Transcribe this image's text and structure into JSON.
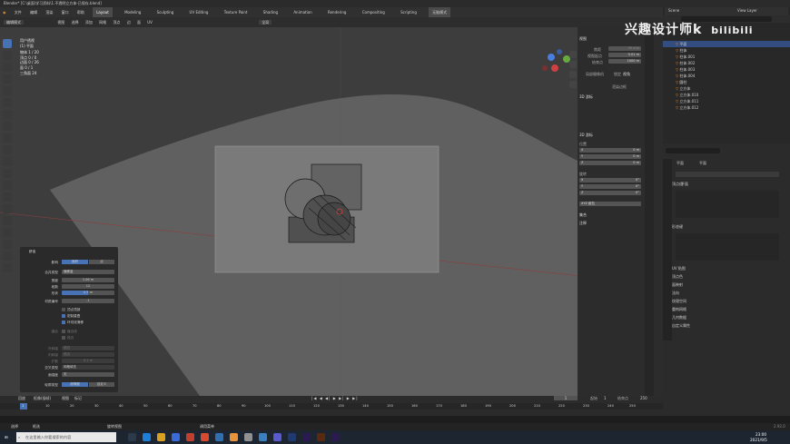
{
  "titlebar": {
    "title": "Blender* [C:\\桌面\\学习资料\\1.不透明立方体-已保存.blend]"
  },
  "menus": [
    "文件",
    "编辑",
    "渲染",
    "窗口",
    "帮助"
  ],
  "workspaces": [
    {
      "label": "Layout",
      "active": true
    },
    {
      "label": "Modeling",
      "active": false
    },
    {
      "label": "Sculpting",
      "active": false
    },
    {
      "label": "UV Editing",
      "active": false
    },
    {
      "label": "Texture Paint",
      "active": false
    },
    {
      "label": "Shading",
      "active": false
    },
    {
      "label": "Animation",
      "active": false
    },
    {
      "label": "Rendering",
      "active": false
    },
    {
      "label": "Compositing",
      "active": false
    },
    {
      "label": "Scripting",
      "active": false
    }
  ],
  "topright": {
    "scene": "Scene",
    "view_layer": "View Layer",
    "mode_badge": "无脑模式"
  },
  "viewport_header": {
    "mode": "编辑模式",
    "items": [
      "视图",
      "选择",
      "添加",
      "网格",
      "顶点",
      "边",
      "面",
      "UV"
    ],
    "orientation": "全局"
  },
  "viewport_info": {
    "line1": "用户透视",
    "line2": "(1) 平面",
    "stats": [
      "物体  1 / 20",
      "顶点  0 / 0",
      "边面  0 / 26",
      "面  0 / 1",
      "三角面  24"
    ]
  },
  "npanel": {
    "view_title": "视图",
    "focal_label": "焦距",
    "focal_value": "50 mm",
    "clip_start_label": "视图起点",
    "clip_start_value": "0.01 m",
    "clip_end_label": "结束点",
    "clip_end_value": "1000 m",
    "local_camera_label": "局部摄像机",
    "lock_label": "锁定",
    "lock_value": "视角",
    "render_region": "渲染边框",
    "cursor_title": "3D 游标",
    "cursor_location": "位置",
    "x_label": "X",
    "y_label": "Y",
    "z_label": "Z",
    "loc_x": "0 m",
    "loc_y": "0 m",
    "loc_z": "0 m",
    "cursor_rotation": "旋转",
    "rot_x": "0°",
    "rot_y": "0°",
    "rot_z": "0°",
    "rot_mode": "XYZ 欧拉",
    "collections": "集合",
    "annotations": "注释"
  },
  "operator": {
    "title": "挤出",
    "flip_label": "影响",
    "flip_a": "面积",
    "flip_b": "点",
    "fill_label": "合并类型",
    "fill_value": "偏移量",
    "width_label": "宽度",
    "width_value": "1.06 m",
    "segments_label": "段数",
    "segments_value": "12",
    "profile_label": "形状",
    "profile_value": "0.5 m",
    "material_label": "材质编号",
    "material_value": "-1",
    "chk1": "顶点顶部",
    "chk2": "钳制重叠",
    "chk3": "环切线滑移",
    "seam_label": "缝合",
    "seam_value": "缝合线",
    "sharp_value": "锐边",
    "miter_outer_label": "外斜接",
    "miter_outer_value": "锐边",
    "miter_inner_label": "内斜接",
    "miter_inner_value": "锐边",
    "spread_label": "扩散",
    "spread_value": "0.1 m",
    "intersect_label": "交叉类型",
    "intersect_value": "网格填充",
    "face_label": "面强度",
    "face_value": "无",
    "profile_type_label": "轮廓类型",
    "profile_type_a": "超椭圆",
    "profile_type_b": "自定义"
  },
  "outliner": [
    {
      "name": "平面",
      "selected": true
    },
    {
      "name": "柱体"
    },
    {
      "name": "柱体.001"
    },
    {
      "name": "柱体.002"
    },
    {
      "name": "柱体.003"
    },
    {
      "name": "柱体.004"
    },
    {
      "name": "圆柱"
    },
    {
      "name": "立方体"
    },
    {
      "name": "立方体.010"
    },
    {
      "name": "立方体.011"
    },
    {
      "name": "立方体.012"
    }
  ],
  "properties": {
    "object_label": "平面",
    "data_label": "平面",
    "mesh_name": "平面",
    "vertex_groups": "顶点组",
    "shape_keys": "形态键",
    "sections": [
      "UV 贴图",
      "顶点色",
      "面映射",
      "法向",
      "纹理空间",
      "重构网格",
      "几何数据",
      "自定义属性"
    ]
  },
  "timeline": {
    "menus": [
      "回放",
      "抠像(插帧)",
      "视图",
      "标记"
    ],
    "current_frame": "1",
    "start_label": "起始",
    "start_value": "1",
    "end_label": "结束点",
    "end_value": "250",
    "ruler": [
      "1",
      "10",
      "20",
      "30",
      "40",
      "50",
      "60",
      "70",
      "80",
      "90",
      "100",
      "110",
      "120",
      "130",
      "140",
      "150",
      "160",
      "170",
      "180",
      "190",
      "200",
      "210",
      "220",
      "230",
      "240",
      "250"
    ]
  },
  "statusbar": {
    "select": "选择",
    "box": "框选",
    "rotate": "旋转视图",
    "context": "调用菜单",
    "version": "2.92.0"
  },
  "taskbar": {
    "search_placeholder": "在这里输入你要搜索的内容",
    "time": "23:00",
    "date": "2021/9/5"
  },
  "watermark": {
    "text": "兴趣设计师k",
    "brand": "bilibili"
  },
  "colors": {
    "accent": "#4772b3",
    "selected_orange": "#e8923a",
    "bg": "#3d3d3d"
  }
}
